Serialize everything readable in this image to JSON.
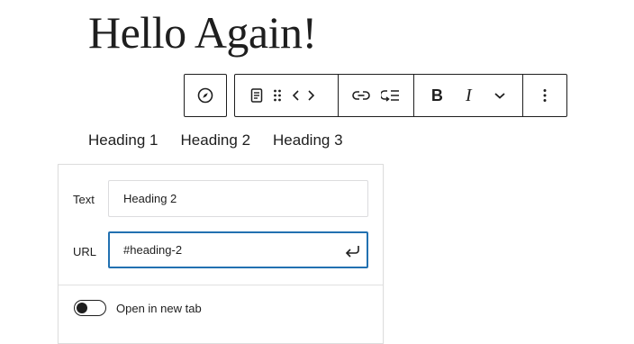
{
  "page": {
    "title": "Hello Again!"
  },
  "toolbar": {
    "icons": [
      "compass-icon",
      "paragraph-icon",
      "drag-handle-icon",
      "code-icon",
      "link-icon",
      "list-indent-icon",
      "bold-icon",
      "italic-icon",
      "chevron-down-icon",
      "more-options-icon"
    ],
    "bold_label": "B",
    "italic_label": "I"
  },
  "heading_links": [
    "Heading 1",
    "Heading 2",
    "Heading 3"
  ],
  "link_popover": {
    "text_label": "Text",
    "text_value": "Heading 2",
    "url_label": "URL",
    "url_value": "#heading-2",
    "new_tab_label": "Open in new tab",
    "new_tab_enabled": false,
    "accent_color": "#2271b1"
  }
}
